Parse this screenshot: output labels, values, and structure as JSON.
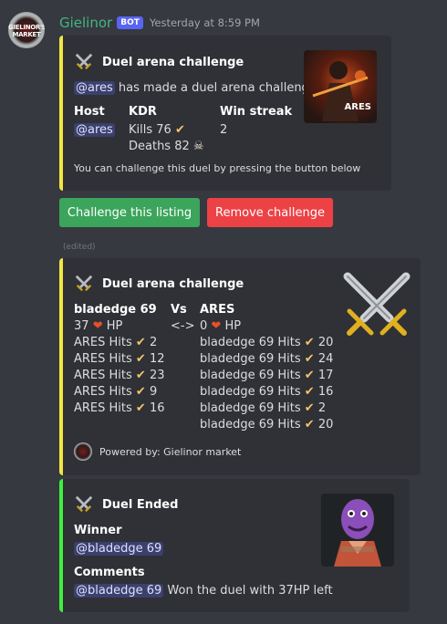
{
  "message": {
    "author": "Gielinor",
    "bot_tag": "BOT",
    "timestamp": "Yesterday at 8:59 PM",
    "avatar_text": "GIELINOR'S MARKET"
  },
  "embed1": {
    "title": "Duel arena challenge",
    "description_mention": "@ares",
    "description_text": " has made a duel arena challenge.",
    "thumb_text": "ARES",
    "fields": {
      "host_name": "Host",
      "host_value": "@ares",
      "kdr_name": "KDR",
      "kdr_kills": "Kills 76",
      "kdr_deaths": "Deaths 82",
      "streak_name": "Win streak",
      "streak_value": "2"
    },
    "footer_text": "You can challenge this duel by pressing the button below"
  },
  "buttons": {
    "challenge": "Challenge this listing",
    "remove": "Remove challenge"
  },
  "edited": "(edited)",
  "embed2": {
    "title": "Duel arena challenge",
    "player1": "bladedge 69",
    "vs": "Vs",
    "player2": "ARES",
    "p1_hp": "37",
    "arrow": "<->",
    "p2_hp": "0",
    "hp_label": "HP",
    "p1_hits": [
      {
        "label": "ARES Hits",
        "value": "2"
      },
      {
        "label": "ARES Hits",
        "value": "12"
      },
      {
        "label": "ARES Hits",
        "value": "23"
      },
      {
        "label": "ARES Hits",
        "value": "9"
      },
      {
        "label": "ARES Hits",
        "value": "16"
      }
    ],
    "p2_hits": [
      {
        "label": "bladedge 69 Hits",
        "value": "20"
      },
      {
        "label": "bladedge 69 Hits",
        "value": "24"
      },
      {
        "label": "bladedge 69 Hits",
        "value": "17"
      },
      {
        "label": "bladedge 69 Hits",
        "value": "16"
      },
      {
        "label": "bladedge 69 Hits",
        "value": "2"
      },
      {
        "label": "bladedge 69 Hits",
        "value": "20"
      }
    ],
    "footer": "Powered by: Gielinor market"
  },
  "embed3": {
    "title": "Duel Ended",
    "winner_name": "Winner",
    "winner_value": "@bladedge 69",
    "comments_name": "Comments",
    "comments_mention": "@bladedge 69",
    "comments_text": " Won the duel with 37HP left"
  },
  "colors": {
    "background": "#36393f",
    "embed_bg": "#2f3136",
    "yellow_bar": "#f1e640",
    "green_bar": "#3ef03e",
    "button_green": "#3ba55c",
    "button_red": "#ed4245",
    "username": "#43b581",
    "bot_tag": "#5865f2"
  },
  "icons": [
    "crossed-swords-icon",
    "check-icon",
    "heart-icon",
    "skull-icon"
  ]
}
